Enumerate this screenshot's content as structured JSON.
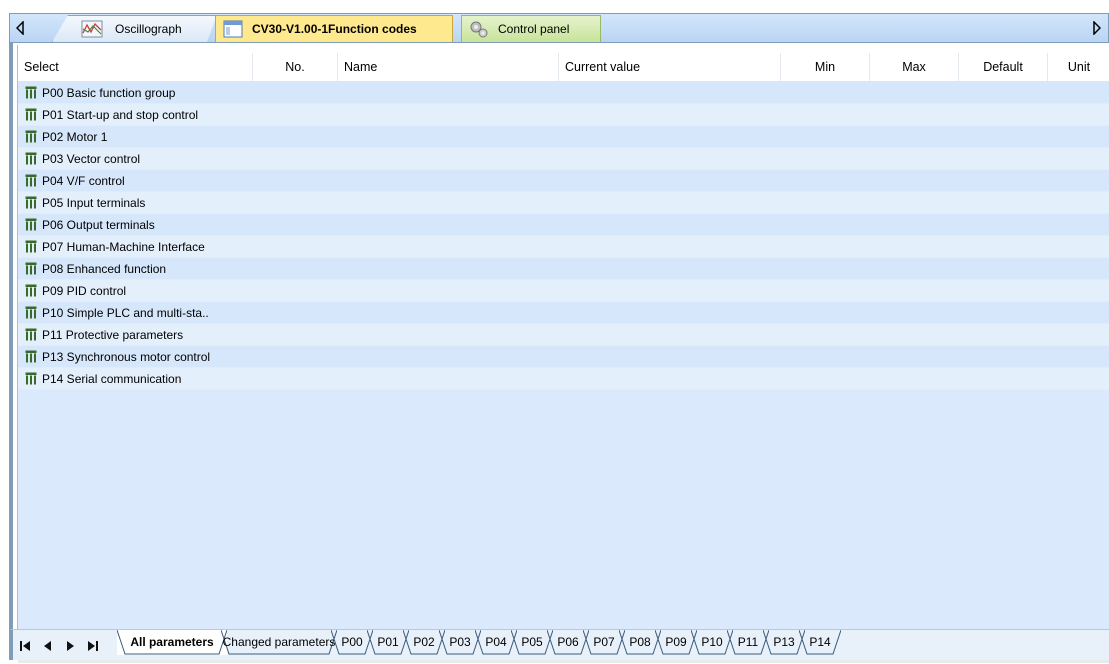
{
  "tabs": [
    {
      "label": "Oscillograph",
      "icon": "oscillograph-icon"
    },
    {
      "label": "CV30-V1.00-1Function codes",
      "icon": "function-codes-icon"
    },
    {
      "label": "Control panel",
      "icon": "gears-icon"
    }
  ],
  "grid": {
    "columns": [
      "Select",
      "No.",
      "Name",
      "Current value",
      "Min",
      "Max",
      "Default",
      "Unit"
    ],
    "groups": [
      "P00 Basic function group",
      "P01 Start-up and stop control",
      "P02 Motor 1",
      "P03 Vector control",
      "P04 V/F control",
      "P05 Input terminals",
      "P06 Output terminals",
      "P07 Human-Machine Interface",
      "P08 Enhanced function",
      "P09 PID control",
      "P10 Simple PLC and multi-sta..",
      "P11 Protective parameters",
      "P13 Synchronous motor control",
      "P14 Serial communication"
    ]
  },
  "sheet_tabs": [
    "All parameters",
    "Changed parameters",
    "P00",
    "P01",
    "P02",
    "P03",
    "P04",
    "P05",
    "P06",
    "P07",
    "P08",
    "P09",
    "P10",
    "P11",
    "P13",
    "P14"
  ],
  "active_sheet": "All parameters",
  "colors": {
    "active_tab": "#ffe98f",
    "row_a": "#d6e7fb",
    "row_b": "#e4effc",
    "folder_icon": "#3a6a2a"
  }
}
